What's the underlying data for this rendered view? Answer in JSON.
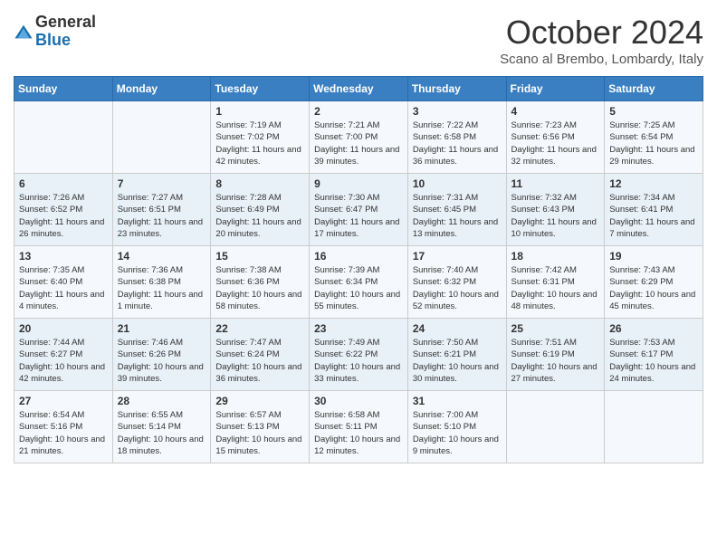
{
  "header": {
    "logo_general": "General",
    "logo_blue": "Blue",
    "month_title": "October 2024",
    "subtitle": "Scano al Brembo, Lombardy, Italy"
  },
  "days_of_week": [
    "Sunday",
    "Monday",
    "Tuesday",
    "Wednesday",
    "Thursday",
    "Friday",
    "Saturday"
  ],
  "weeks": [
    [
      {
        "day": "",
        "info": ""
      },
      {
        "day": "",
        "info": ""
      },
      {
        "day": "1",
        "info": "Sunrise: 7:19 AM\nSunset: 7:02 PM\nDaylight: 11 hours and 42 minutes."
      },
      {
        "day": "2",
        "info": "Sunrise: 7:21 AM\nSunset: 7:00 PM\nDaylight: 11 hours and 39 minutes."
      },
      {
        "day": "3",
        "info": "Sunrise: 7:22 AM\nSunset: 6:58 PM\nDaylight: 11 hours and 36 minutes."
      },
      {
        "day": "4",
        "info": "Sunrise: 7:23 AM\nSunset: 6:56 PM\nDaylight: 11 hours and 32 minutes."
      },
      {
        "day": "5",
        "info": "Sunrise: 7:25 AM\nSunset: 6:54 PM\nDaylight: 11 hours and 29 minutes."
      }
    ],
    [
      {
        "day": "6",
        "info": "Sunrise: 7:26 AM\nSunset: 6:52 PM\nDaylight: 11 hours and 26 minutes."
      },
      {
        "day": "7",
        "info": "Sunrise: 7:27 AM\nSunset: 6:51 PM\nDaylight: 11 hours and 23 minutes."
      },
      {
        "day": "8",
        "info": "Sunrise: 7:28 AM\nSunset: 6:49 PM\nDaylight: 11 hours and 20 minutes."
      },
      {
        "day": "9",
        "info": "Sunrise: 7:30 AM\nSunset: 6:47 PM\nDaylight: 11 hours and 17 minutes."
      },
      {
        "day": "10",
        "info": "Sunrise: 7:31 AM\nSunset: 6:45 PM\nDaylight: 11 hours and 13 minutes."
      },
      {
        "day": "11",
        "info": "Sunrise: 7:32 AM\nSunset: 6:43 PM\nDaylight: 11 hours and 10 minutes."
      },
      {
        "day": "12",
        "info": "Sunrise: 7:34 AM\nSunset: 6:41 PM\nDaylight: 11 hours and 7 minutes."
      }
    ],
    [
      {
        "day": "13",
        "info": "Sunrise: 7:35 AM\nSunset: 6:40 PM\nDaylight: 11 hours and 4 minutes."
      },
      {
        "day": "14",
        "info": "Sunrise: 7:36 AM\nSunset: 6:38 PM\nDaylight: 11 hours and 1 minute."
      },
      {
        "day": "15",
        "info": "Sunrise: 7:38 AM\nSunset: 6:36 PM\nDaylight: 10 hours and 58 minutes."
      },
      {
        "day": "16",
        "info": "Sunrise: 7:39 AM\nSunset: 6:34 PM\nDaylight: 10 hours and 55 minutes."
      },
      {
        "day": "17",
        "info": "Sunrise: 7:40 AM\nSunset: 6:32 PM\nDaylight: 10 hours and 52 minutes."
      },
      {
        "day": "18",
        "info": "Sunrise: 7:42 AM\nSunset: 6:31 PM\nDaylight: 10 hours and 48 minutes."
      },
      {
        "day": "19",
        "info": "Sunrise: 7:43 AM\nSunset: 6:29 PM\nDaylight: 10 hours and 45 minutes."
      }
    ],
    [
      {
        "day": "20",
        "info": "Sunrise: 7:44 AM\nSunset: 6:27 PM\nDaylight: 10 hours and 42 minutes."
      },
      {
        "day": "21",
        "info": "Sunrise: 7:46 AM\nSunset: 6:26 PM\nDaylight: 10 hours and 39 minutes."
      },
      {
        "day": "22",
        "info": "Sunrise: 7:47 AM\nSunset: 6:24 PM\nDaylight: 10 hours and 36 minutes."
      },
      {
        "day": "23",
        "info": "Sunrise: 7:49 AM\nSunset: 6:22 PM\nDaylight: 10 hours and 33 minutes."
      },
      {
        "day": "24",
        "info": "Sunrise: 7:50 AM\nSunset: 6:21 PM\nDaylight: 10 hours and 30 minutes."
      },
      {
        "day": "25",
        "info": "Sunrise: 7:51 AM\nSunset: 6:19 PM\nDaylight: 10 hours and 27 minutes."
      },
      {
        "day": "26",
        "info": "Sunrise: 7:53 AM\nSunset: 6:17 PM\nDaylight: 10 hours and 24 minutes."
      }
    ],
    [
      {
        "day": "27",
        "info": "Sunrise: 6:54 AM\nSunset: 5:16 PM\nDaylight: 10 hours and 21 minutes."
      },
      {
        "day": "28",
        "info": "Sunrise: 6:55 AM\nSunset: 5:14 PM\nDaylight: 10 hours and 18 minutes."
      },
      {
        "day": "29",
        "info": "Sunrise: 6:57 AM\nSunset: 5:13 PM\nDaylight: 10 hours and 15 minutes."
      },
      {
        "day": "30",
        "info": "Sunrise: 6:58 AM\nSunset: 5:11 PM\nDaylight: 10 hours and 12 minutes."
      },
      {
        "day": "31",
        "info": "Sunrise: 7:00 AM\nSunset: 5:10 PM\nDaylight: 10 hours and 9 minutes."
      },
      {
        "day": "",
        "info": ""
      },
      {
        "day": "",
        "info": ""
      }
    ]
  ]
}
